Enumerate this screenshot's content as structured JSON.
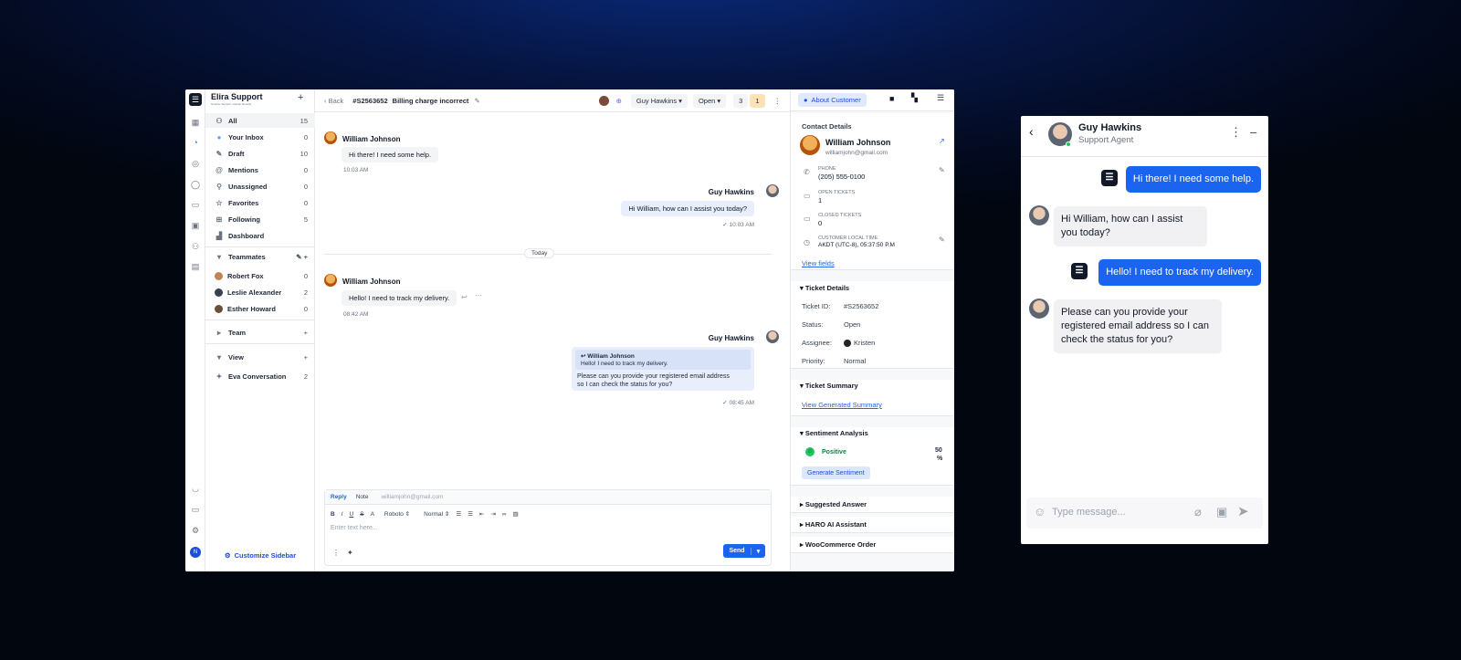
{
  "sidebar": {
    "brand": "Elira Support",
    "tagline": "Smarter Support. Human Results",
    "items": [
      {
        "label": "All",
        "count": "15"
      },
      {
        "label": "Your Inbox",
        "count": "0"
      },
      {
        "label": "Draft",
        "count": "10"
      },
      {
        "label": "Mentions",
        "count": "0"
      },
      {
        "label": "Unassigned",
        "count": "0"
      },
      {
        "label": "Favorites",
        "count": "0"
      },
      {
        "label": "Following",
        "count": "5"
      },
      {
        "label": "Dashboard",
        "count": ""
      }
    ],
    "teammates_title": "Teammates",
    "teammates": [
      {
        "label": "Robert Fox",
        "count": "0"
      },
      {
        "label": "Leslie Alexander",
        "count": "2"
      },
      {
        "label": "Esther Howard",
        "count": "0"
      }
    ],
    "team_title": "Team",
    "view_title": "View",
    "views": [
      {
        "label": "Eva Conversation",
        "count": "2"
      }
    ],
    "customize": "Customize Sidebar",
    "avatar_initial": "N"
  },
  "header": {
    "back": "Back",
    "ticket_id": "#S2563652",
    "ticket_title": "Billing charge incorrect",
    "assignee": "Guy Hawkins",
    "status": "Open",
    "count_a": "3",
    "count_b": "1",
    "about": "About Customer"
  },
  "messages": {
    "m1": {
      "name": "William Johnson",
      "text": "Hi there! I need some help.",
      "time": "10:03 AM"
    },
    "m2": {
      "name": "Guy Hawkins",
      "text": "Hi William, how can I assist you today?",
      "time": "10:03 AM"
    },
    "divider": "Today",
    "m3": {
      "name": "William Johnson",
      "text": "Hello! I need to track my delivery.",
      "time": "08:42 AM"
    },
    "m4": {
      "name": "Guy Hawkins",
      "quote_name": "William Johnson",
      "quote_text": "Hello! I need to track my delivery.",
      "text1": "Please can you provide your registered email address",
      "text2": "so I can check the status for you?",
      "time": "08:45 AM"
    }
  },
  "composer": {
    "tab_reply": "Reply",
    "tab_note": "Note",
    "email": "williamjohn@gmail.com",
    "font": "Roboto",
    "size": "Normal",
    "placeholder": "Enter text here...",
    "send": "Send"
  },
  "customer": {
    "section": "Contact Details",
    "name": "William Johnson",
    "email": "williamjohn@gmail.com",
    "phone_label": "PHONE",
    "phone": "(205) 555-0100",
    "open_label": "OPEN TICKETS",
    "open": "1",
    "closed_label": "CLOSED TICKETS",
    "closed": "0",
    "tz_label": "CUSTOMER LOCAL TIME",
    "tz": "AKDT (UTC-8), 05:37:50 P.M",
    "view_fields": "View fields"
  },
  "ticket": {
    "section": "Ticket Details",
    "id_k": "Ticket ID:",
    "id_v": "#S2563652",
    "status_k": "Status:",
    "status_v": "Open",
    "assignee_k": "Assignee:",
    "assignee_v": "Kristen",
    "priority_k": "Priority:",
    "priority_v": "Normal"
  },
  "summary": {
    "section": "Ticket Summary",
    "link": "View Generated Summary"
  },
  "sentiment": {
    "section": "Sentiment Analysis",
    "label": "Positive",
    "value": "50",
    "unit": "%",
    "button": "Generate Sentiment"
  },
  "collapsed": [
    "Suggested Answer",
    "HARO AI Assistant",
    "WooCommerce Order"
  ],
  "mobile": {
    "name": "Guy Hawkins",
    "role": "Support Agent",
    "msgs": [
      "Hi there! I need some help.",
      "Hi William, how can I assist you today?",
      "Hello! I need to track my delivery.",
      "Please can you provide your registered email address so I can check the status for you?"
    ],
    "placeholder": "Type message..."
  },
  "colors": {
    "accent": "#1a64f0",
    "badge": "#fde3b3",
    "positive": "#22c55e"
  }
}
